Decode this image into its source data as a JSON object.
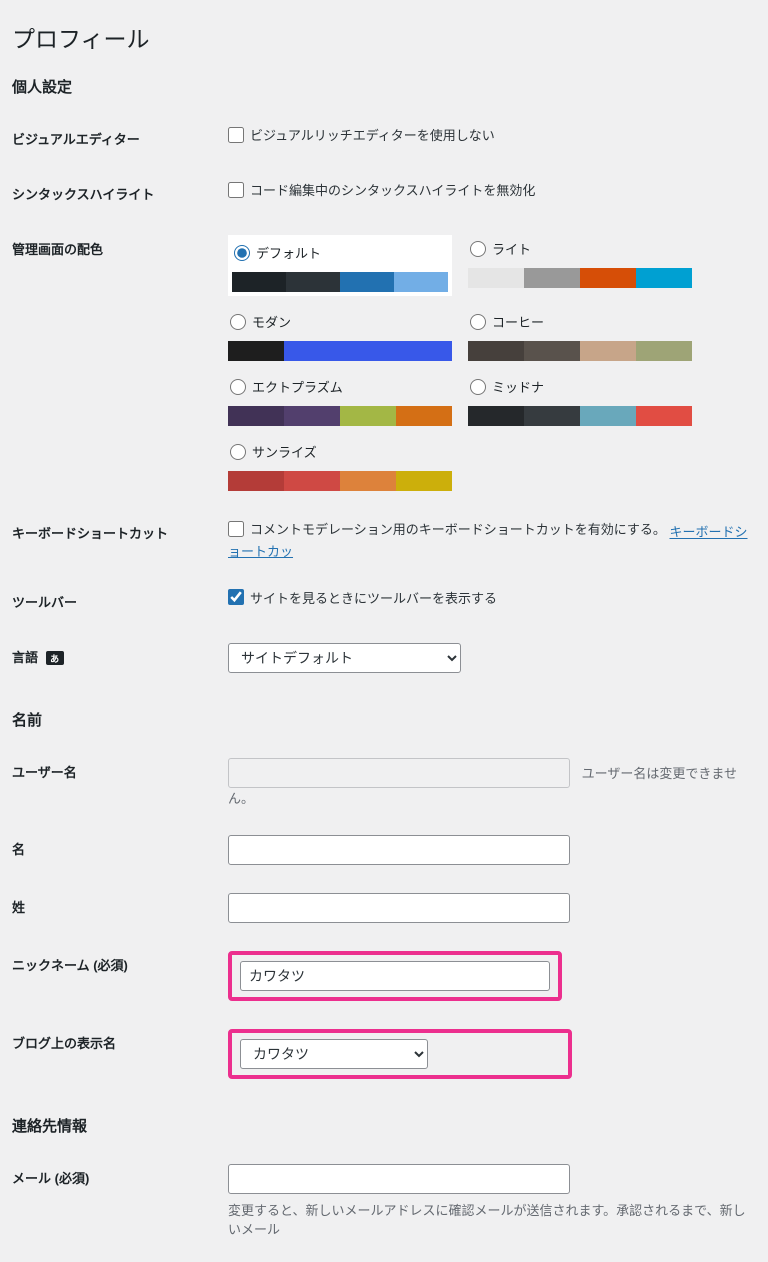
{
  "page_title": "プロフィール",
  "sections": {
    "personal": "個人設定",
    "name": "名前",
    "contact": "連絡先情報"
  },
  "rows": {
    "visual_editor": {
      "label": "ビジュアルエディター",
      "checkbox": "ビジュアルリッチエディターを使用しない"
    },
    "syntax": {
      "label": "シンタックスハイライト",
      "checkbox": "コード編集中のシンタックスハイライトを無効化"
    },
    "color": {
      "label": "管理画面の配色"
    },
    "keyboard": {
      "label": "キーボードショートカット",
      "checkbox": "コメントモデレーション用のキーボードショートカットを有効にする。",
      "link": "キーボードショートカッ"
    },
    "toolbar": {
      "label": "ツールバー",
      "checkbox": "サイトを見るときにツールバーを表示する"
    },
    "language": {
      "label": "言語",
      "value": "サイトデフォルト"
    },
    "username": {
      "label": "ユーザー名",
      "desc": "ユーザー名は変更できません。"
    },
    "first_name": {
      "label": "名"
    },
    "last_name": {
      "label": "姓"
    },
    "nickname": {
      "label": "ニックネーム (必須)",
      "value": "カワタツ"
    },
    "display_name": {
      "label": "ブログ上の表示名",
      "value": "カワタツ"
    },
    "email": {
      "label": "メール (必須)",
      "desc": "変更すると、新しいメールアドレスに確認メールが送信されます。承認されるまで、新しいメール"
    }
  },
  "schemes": [
    {
      "name": "デフォルト",
      "selected": true,
      "colors": [
        "#1d2327",
        "#2c3338",
        "#2271b1",
        "#72aee6"
      ]
    },
    {
      "name": "ライト",
      "colors": [
        "#e5e5e5",
        "#999999",
        "#d64e07",
        "#00a0d2"
      ]
    },
    {
      "name": "モダン",
      "colors": [
        "#1e1e1e",
        "#3858e9",
        "#3858e9",
        "#3858e9"
      ]
    },
    {
      "name": "コーヒー",
      "colors": [
        "#46403c",
        "#59524c",
        "#c7a589",
        "#9ea476"
      ]
    },
    {
      "name": "エクトプラズム",
      "colors": [
        "#413256",
        "#523f6d",
        "#a3b745",
        "#d46f15"
      ]
    },
    {
      "name": "ミッドナ",
      "colors": [
        "#25282b",
        "#363b3f",
        "#69a8bb",
        "#e14d43"
      ]
    },
    {
      "name": "サンライズ",
      "colors": [
        "#b43c38",
        "#cf4944",
        "#dd823b",
        "#ccaf0b"
      ]
    }
  ]
}
